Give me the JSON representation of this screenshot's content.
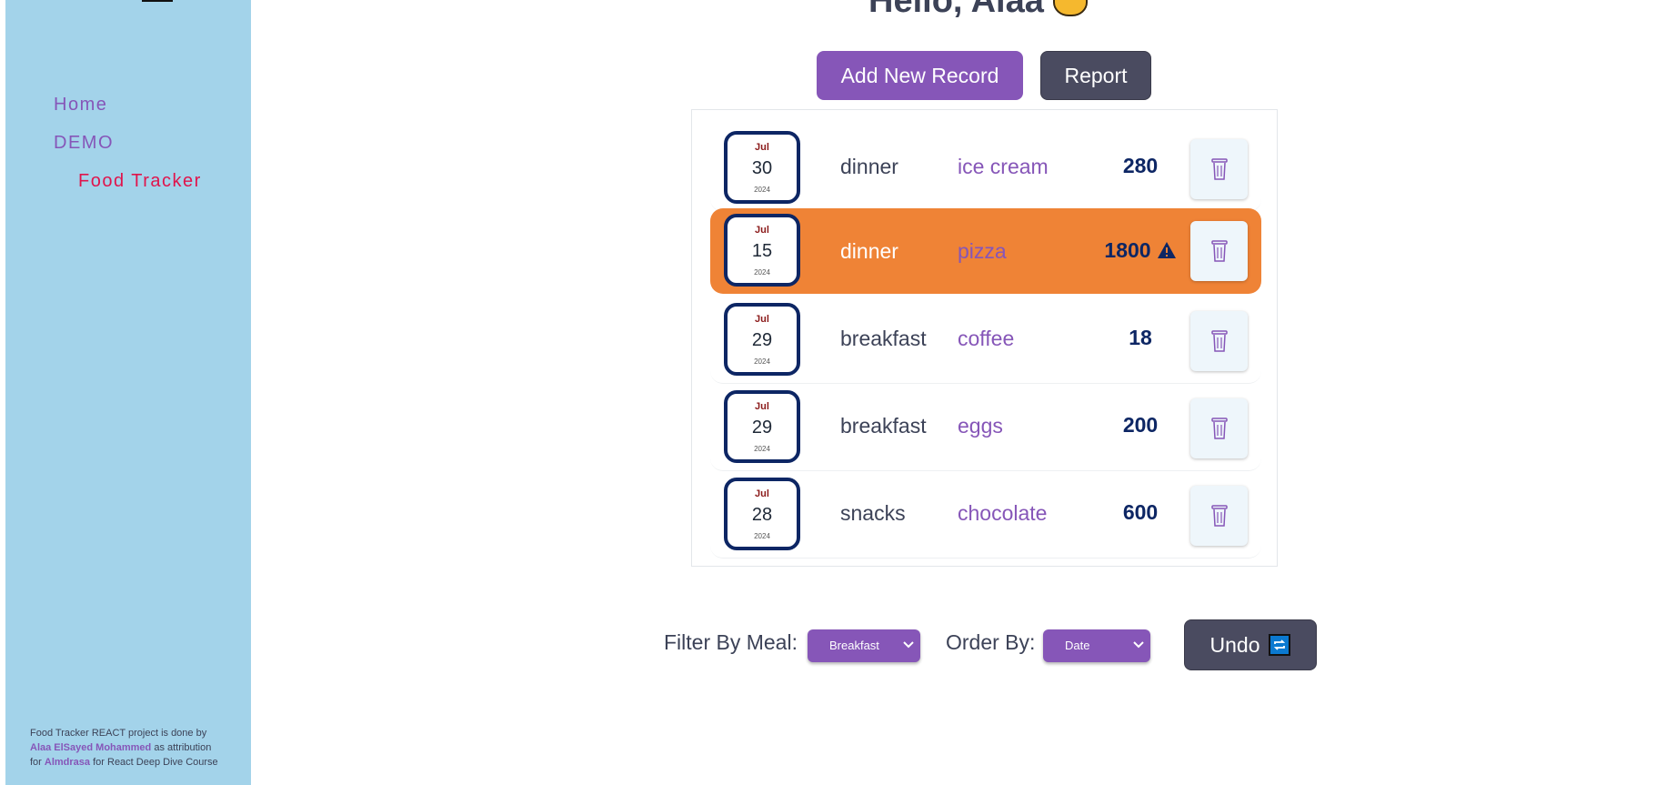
{
  "header": {
    "greeting": "Hello, Alaa"
  },
  "sidebar": {
    "items": [
      {
        "label": "Home"
      },
      {
        "label": "DEMO"
      },
      {
        "label": "Food Tracker",
        "active": true
      }
    ],
    "attribution": {
      "line1": "Food Tracker REACT project is done by",
      "author": "Alaa ElSayed Mohammed",
      "line2": " as attribution",
      "line3_prefix": "for ",
      "org": "Almdrasa",
      "line3_suffix": " for React Deep Dive Course"
    }
  },
  "toolbar": {
    "add_label": "Add New Record",
    "report_label": "Report"
  },
  "records": [
    {
      "month": "Jul",
      "day": "30",
      "year": "2024",
      "meal": "dinner",
      "food": "ice cream",
      "calories": "280",
      "warning": false
    },
    {
      "month": "Jul",
      "day": "15",
      "year": "2024",
      "meal": "dinner",
      "food": "pizza",
      "calories": "1800",
      "warning": true
    },
    {
      "month": "Jul",
      "day": "29",
      "year": "2024",
      "meal": "breakfast",
      "food": "coffee",
      "calories": "18",
      "warning": false
    },
    {
      "month": "Jul",
      "day": "29",
      "year": "2024",
      "meal": "breakfast",
      "food": "eggs",
      "calories": "200",
      "warning": false
    },
    {
      "month": "Jul",
      "day": "28",
      "year": "2024",
      "meal": "snacks",
      "food": "chocolate",
      "calories": "600",
      "warning": false
    }
  ],
  "filters": {
    "meal_label": "Filter By Meal:",
    "meal_value": "Breakfast",
    "order_label": "Order By:",
    "order_value": "Date",
    "undo_label": "Undo"
  },
  "colors": {
    "sidebar_bg": "#a3d3ea",
    "accent": "#8656b8",
    "highlight_row": "#ef8336",
    "navy": "#0d2664",
    "active_link": "#e0144c"
  }
}
